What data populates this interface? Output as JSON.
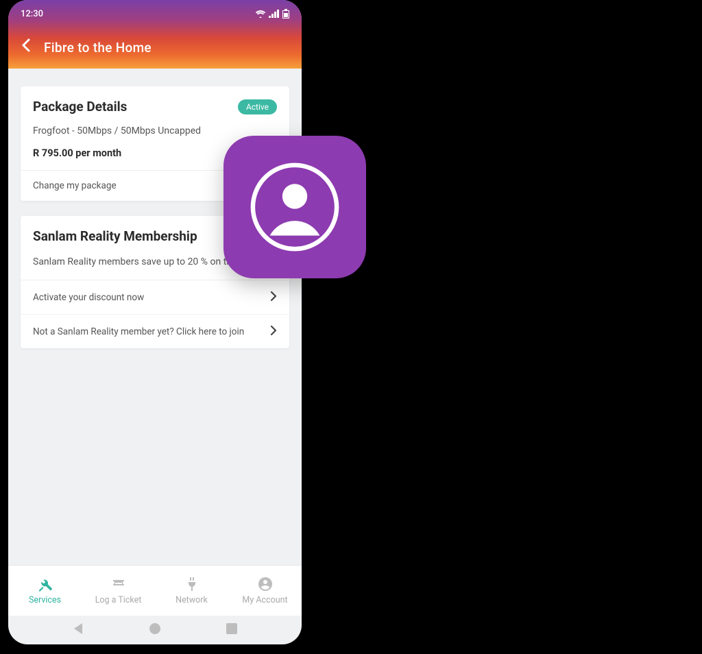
{
  "status": {
    "time": "12:30"
  },
  "header": {
    "title": "Fibre to the Home"
  },
  "package": {
    "title": "Package Details",
    "badge": "Active",
    "plan": "Frogfoot - 50Mbps / 50Mbps Uncapped",
    "price": "R 795.00 per month",
    "change": "Change my package"
  },
  "membership": {
    "title": "Sanlam Reality Membership",
    "blurb": "Sanlam Reality members save up to 20 % on their bill.",
    "activate": "Activate your discount now",
    "join": "Not a Sanlam Reality member yet? Click here to join"
  },
  "nav": {
    "services": "Services",
    "ticket": "Log a Ticket",
    "network": "Network",
    "account": "My Account"
  }
}
